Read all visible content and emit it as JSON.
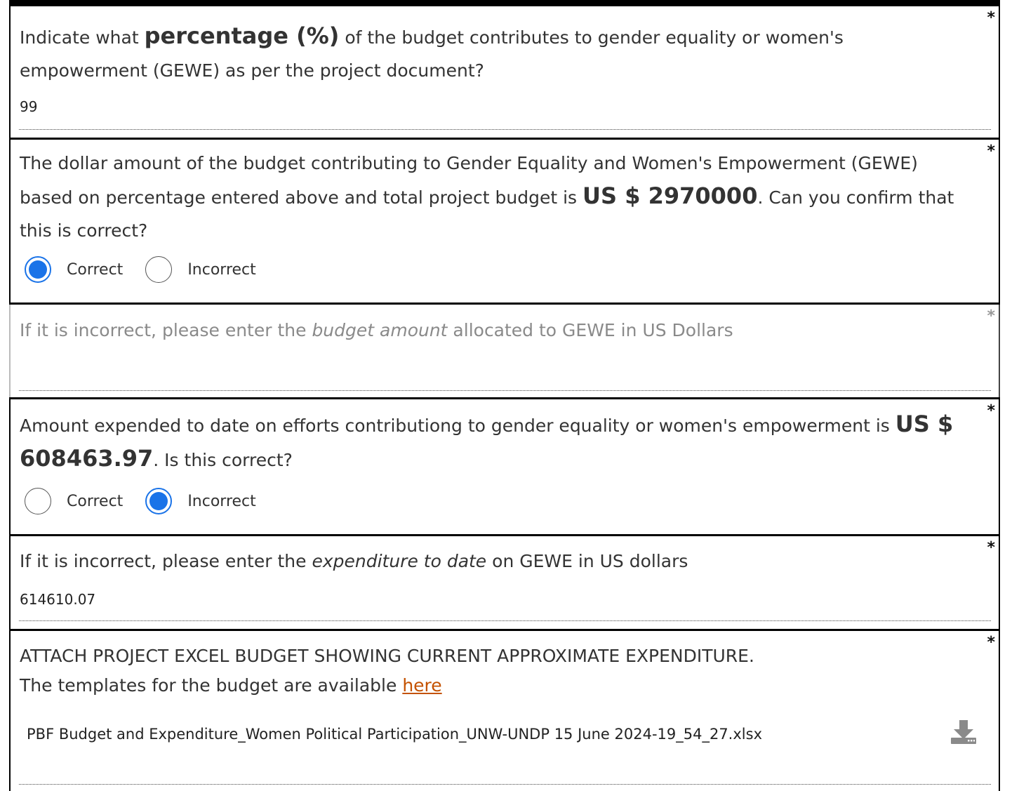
{
  "questions": {
    "q1": {
      "prefix": "Indicate what ",
      "bold": "percentage (%)",
      "suffix": " of the budget contributes to gender equality or women's empowerment (GEWE) as per the project document?",
      "answer": "99",
      "required": "*"
    },
    "q2": {
      "prefix": "The dollar amount of the budget contributing to Gender Equality and Women's Empowerment (GEWE) based on percentage entered above and total project budget is ",
      "bold": "US $ 2970000",
      "suffix": ". Can you confirm that this is correct?",
      "options": [
        "Correct",
        "Incorrect"
      ],
      "selected": "Correct",
      "required": "*"
    },
    "q3": {
      "prefix": "If it is incorrect, please enter the ",
      "italic": "budget amount",
      "suffix": " allocated to GEWE in US Dollars",
      "answer": "",
      "required": "*"
    },
    "q4": {
      "prefix": "Amount expended to date on efforts contributiong to gender equality or women's empowerment is ",
      "bold": "US $ 608463.97",
      "suffix": ". Is this correct?",
      "options": [
        "Correct",
        "Incorrect"
      ],
      "selected": "Incorrect",
      "required": "*"
    },
    "q5": {
      "prefix": "If it is incorrect, please enter the ",
      "italic": "expenditure to date",
      "suffix": " on GEWE in US dollars",
      "answer": "614610.07",
      "required": "*"
    },
    "q6": {
      "line1": "ATTACH PROJECT EXCEL BUDGET SHOWING CURRENT APPROXIMATE EXPENDITURE.",
      "line2_prefix": "The templates for the budget are available ",
      "link": "here",
      "file_name": "PBF Budget and Expenditure_Women Political Participation_UNW-UNDP 15 June 2024-19_54_27.xlsx",
      "download_icon": "download-icon",
      "required": "*"
    }
  },
  "colors": {
    "radio_selected": "#1a73e8",
    "link": "#c45200",
    "disabled_text": "#8a8a8a"
  }
}
